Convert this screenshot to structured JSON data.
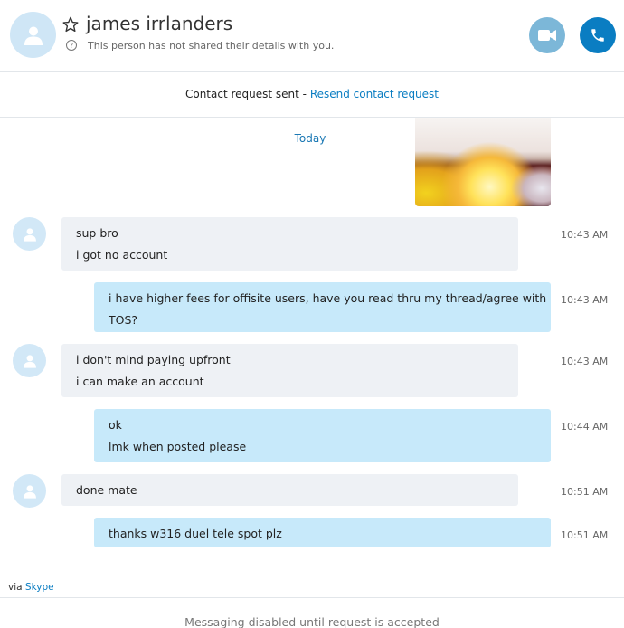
{
  "header": {
    "contact_name": "james irrlanders",
    "status_text": "This person has not shared their details with you.",
    "icons": [
      "avatar-icon",
      "star-icon",
      "info-icon",
      "video-call-icon",
      "phone-call-icon"
    ]
  },
  "request_bar": {
    "text": "Contact request sent - ",
    "link_text": "Resend contact request"
  },
  "conversation": {
    "date_separator": "Today",
    "messages": [
      {
        "direction": "in",
        "lines": [
          "sup bro",
          "i got no account"
        ],
        "time": "10:43 AM"
      },
      {
        "direction": "out",
        "lines": [
          "i have higher fees for offisite users, have you read thru my thread/agree with",
          "TOS?"
        ],
        "time": "10:43 AM"
      },
      {
        "direction": "in",
        "lines": [
          "i don't mind paying upfront",
          "i can make an account"
        ],
        "time": "10:43 AM"
      },
      {
        "direction": "out",
        "lines": [
          "ok",
          "lmk when posted please"
        ],
        "time": "10:44 AM"
      },
      {
        "direction": "in",
        "lines": [
          "done mate"
        ],
        "time": "10:51 AM"
      },
      {
        "direction": "out",
        "lines": [
          "thanks w316 duel tele spot plz"
        ],
        "time": "10:51 AM"
      }
    ]
  },
  "via": {
    "prefix": "via ",
    "link": "Skype"
  },
  "footer": {
    "text": "Messaging disabled until request is accepted"
  },
  "colors": {
    "accent": "#0a7dc2",
    "outgoing_bubble": "#c7e9fa",
    "incoming_bubble": "#eef1f5"
  }
}
